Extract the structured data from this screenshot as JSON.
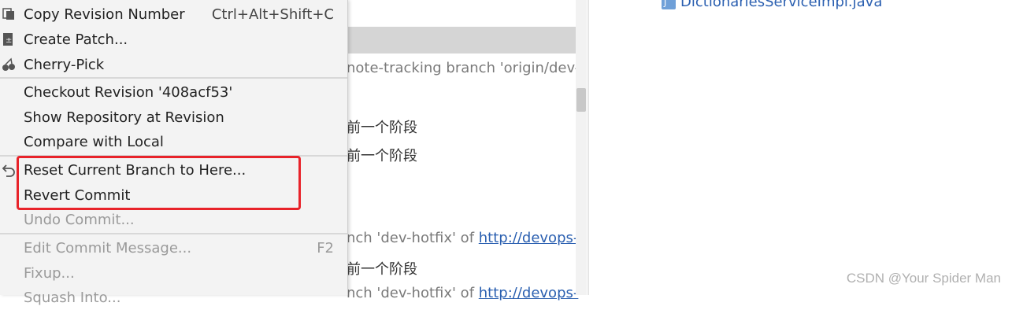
{
  "menu": {
    "items": [
      {
        "label": "Copy Revision Number",
        "shortcut": "Ctrl+Alt+Shift+C",
        "icon": "copy-icon",
        "enabled": true
      },
      {
        "label": "Create Patch...",
        "shortcut": "",
        "icon": "patch-icon",
        "enabled": true
      },
      {
        "label": "Cherry-Pick",
        "shortcut": "",
        "icon": "cherry-icon",
        "enabled": true
      },
      {
        "label": "Checkout Revision '408acf53'",
        "shortcut": "",
        "icon": "",
        "enabled": true
      },
      {
        "label": "Show Repository at Revision",
        "shortcut": "",
        "icon": "",
        "enabled": true
      },
      {
        "label": "Compare with Local",
        "shortcut": "",
        "icon": "",
        "enabled": true
      },
      {
        "label": "Reset Current Branch to Here...",
        "shortcut": "",
        "icon": "undo-icon",
        "enabled": true
      },
      {
        "label": "Revert Commit",
        "shortcut": "",
        "icon": "",
        "enabled": true
      },
      {
        "label": "Undo Commit...",
        "shortcut": "",
        "icon": "",
        "enabled": false
      },
      {
        "label": "Edit Commit Message...",
        "shortcut": "F2",
        "icon": "",
        "enabled": false
      },
      {
        "label": "Fixup...",
        "shortcut": "",
        "icon": "",
        "enabled": false
      },
      {
        "label": "Squash Into...",
        "shortcut": "",
        "icon": "",
        "enabled": false
      }
    ]
  },
  "log": {
    "lines": [
      {
        "text": "note-tracking branch 'origin/dev-l",
        "link": ""
      },
      {
        "text": "前一个阶段",
        "link": ""
      },
      {
        "text": "前一个阶段",
        "link": ""
      },
      {
        "text": "nch 'dev-hotfix' of ",
        "link": "http://devops-"
      },
      {
        "text": "前一个阶段",
        "link": ""
      },
      {
        "text": "nch 'dev-hotfix' of ",
        "link": "http://devops-"
      }
    ]
  },
  "changes": {
    "file_name": "DictionariesServiceImpl.java"
  },
  "watermark": "CSDN @Your Spider Man",
  "colors": {
    "highlight": "#e8232a",
    "menu_bg": "#f3f3f3",
    "link": "#2a5fb0"
  }
}
